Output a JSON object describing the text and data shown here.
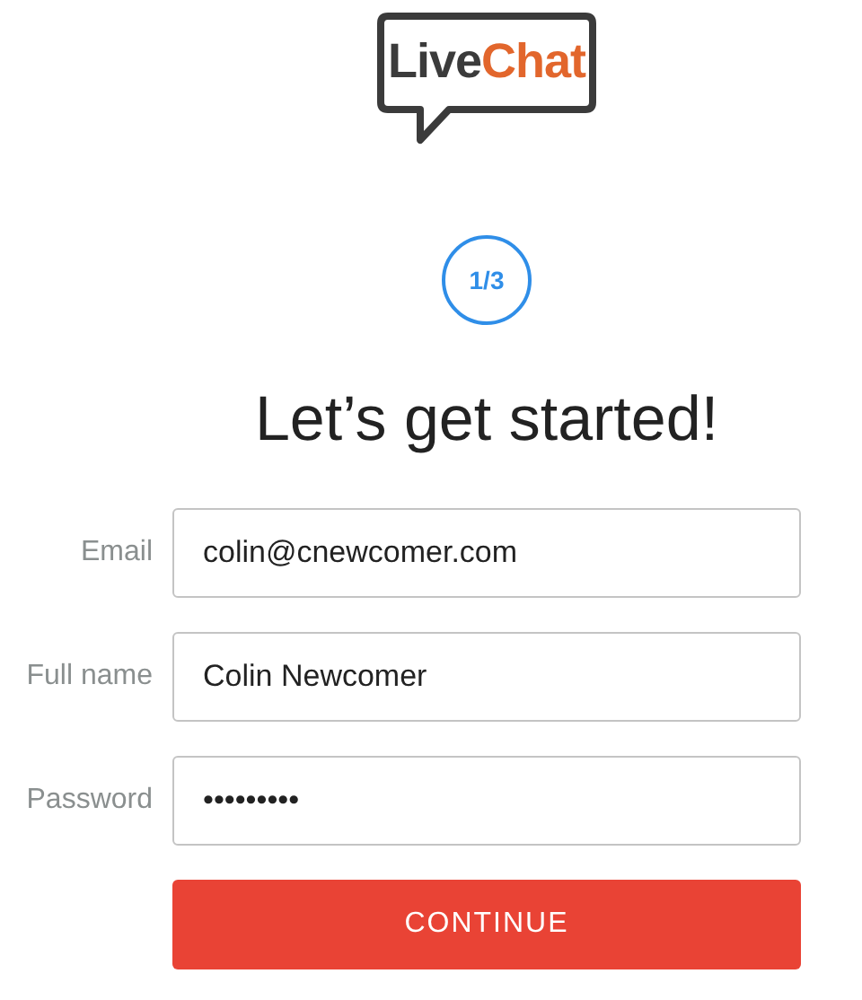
{
  "logo": {
    "parts": [
      {
        "text": "Live",
        "color": "#3b3b3b"
      },
      {
        "text": "Chat",
        "color": "#e2662c"
      }
    ]
  },
  "step": "1/3",
  "heading": "Let’s get started!",
  "fields": [
    {
      "label": "Email",
      "value": "colin@cnewcomer.com"
    },
    {
      "label": "Full name",
      "value": "Colin Newcomer"
    },
    {
      "label": "Password",
      "value": "•••••••••"
    }
  ],
  "button": "CONTINUE"
}
